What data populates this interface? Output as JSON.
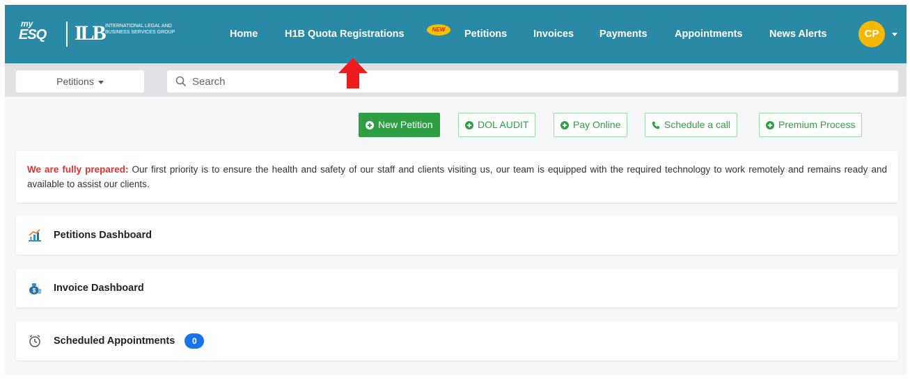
{
  "brand": {
    "logo_my": "my",
    "logo_esq": "ESQ",
    "logo_ilb": "ILB",
    "logo_org": "INTERNATIONAL LEGAL AND BUSINESS SERVICES GROUP"
  },
  "nav": {
    "items": [
      {
        "label": "Home"
      },
      {
        "label": "H1B Quota Registrations"
      },
      {
        "label": "Petitions"
      },
      {
        "label": "Invoices"
      },
      {
        "label": "Payments"
      },
      {
        "label": "Appointments"
      },
      {
        "label": "News Alerts"
      }
    ],
    "new_badge": "NEW",
    "avatar_initials": "CP"
  },
  "search": {
    "scope_label": "Petitions",
    "placeholder": "Search"
  },
  "actions": {
    "new_petition": "New Petition",
    "dol_audit": "DOL AUDIT",
    "pay_online": "Pay Online",
    "schedule_call": "Schedule a call",
    "premium_process": "Premium Process"
  },
  "notice": {
    "strong": "We are fully prepared:",
    "text": " Our first priority is to ensure the health and safety of our staff and clients visiting us, our team is equipped with the required technology to work remotely and remains ready and available to assist our clients."
  },
  "dashboards": {
    "petitions": "Petitions Dashboard",
    "invoice": "Invoice Dashboard",
    "appointments": "Scheduled Appointments",
    "appointments_count": "0"
  },
  "colors": {
    "navbar": "#2a8aa5",
    "accent_green": "#2ea043",
    "alert_red": "#e5302b",
    "badge_blue": "#1a74e8",
    "avatar_yellow": "#f5b800"
  }
}
